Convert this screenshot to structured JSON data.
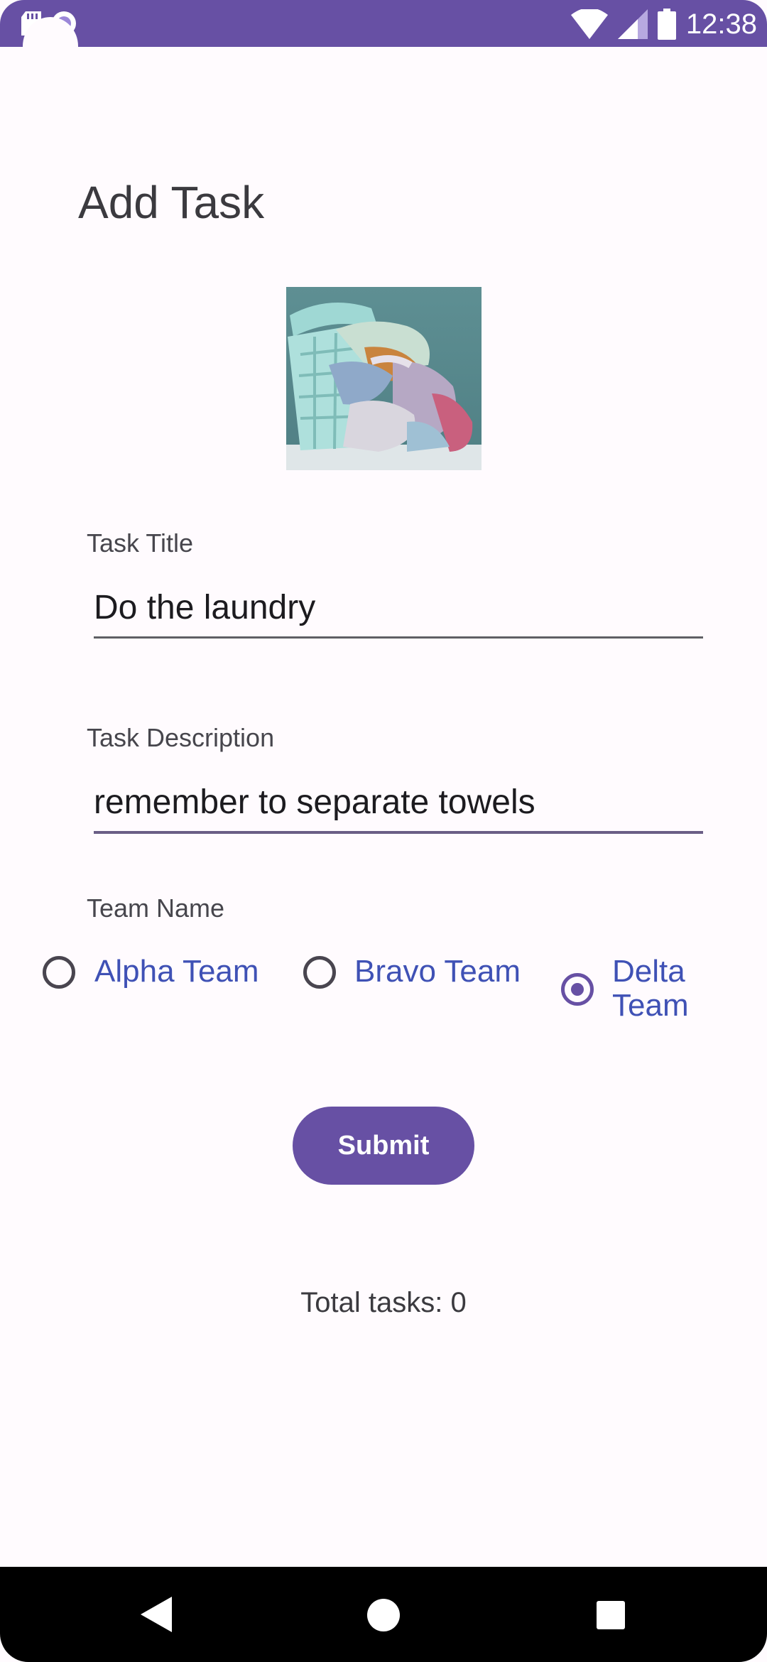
{
  "status_bar": {
    "time": "12:38",
    "background": "#6750a4"
  },
  "page": {
    "title": "Add Task"
  },
  "image": {
    "subject": "laundry basket with clothes"
  },
  "form": {
    "title_label": "Task Title",
    "title_value": "Do the laundry",
    "description_label": "Task Description",
    "description_value": "remember to separate towels",
    "team_label": "Team Name",
    "teams": [
      {
        "label": "Alpha Team",
        "checked": false
      },
      {
        "label": "Bravo Team",
        "checked": false
      },
      {
        "label": "Delta Team",
        "checked": true
      }
    ],
    "submit_label": "Submit"
  },
  "footer": {
    "total_tasks": "Total tasks: 0"
  },
  "colors": {
    "accent": "#6750a4",
    "radio_text": "#3f51b5",
    "background": "#fffbfe"
  },
  "nav_bar": {
    "icons": [
      "back-icon",
      "home-icon",
      "recents-icon"
    ]
  }
}
